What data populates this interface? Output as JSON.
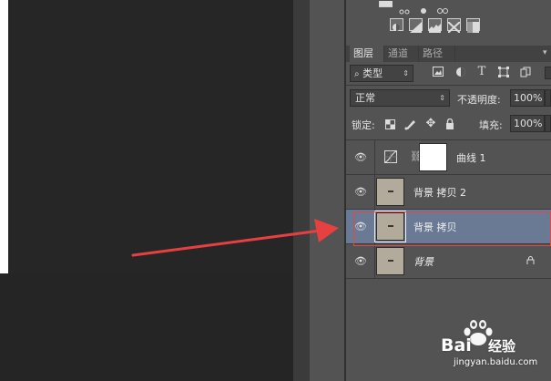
{
  "adjustments_panel": {
    "icons_row1": [
      "levels-icon",
      "curves-mini-icon",
      "exposure-icon",
      "vibrance-icon"
    ],
    "icons_row2": [
      "invert-icon",
      "posterize-icon",
      "threshold-icon",
      "selective-color-icon",
      "gradient-map-icon"
    ]
  },
  "layers_panel": {
    "tabs": [
      {
        "label": "图层",
        "active": true
      },
      {
        "label": "通道",
        "active": false
      },
      {
        "label": "路径",
        "active": false
      }
    ],
    "filter": {
      "icon": "search-icon",
      "value": "类型"
    },
    "filter_icons": [
      "image-filter-icon",
      "adjustment-filter-icon",
      "text-filter-icon",
      "shape-filter-icon",
      "smart-object-filter-icon"
    ],
    "blend_mode": "正常",
    "opacity_label": "不透明度:",
    "opacity_value": "100%",
    "lock_label": "锁定:",
    "fill_label": "填充:",
    "fill_value": "100%",
    "layers": [
      {
        "name": "曲线 1",
        "type": "adjustment",
        "visible": true,
        "selected": false
      },
      {
        "name": "背景 拷贝 2",
        "type": "image",
        "visible": true,
        "selected": false
      },
      {
        "name": "背景 拷贝",
        "type": "image",
        "visible": true,
        "selected": true
      },
      {
        "name": "背景",
        "type": "background",
        "visible": true,
        "selected": false,
        "locked": true
      }
    ]
  },
  "colors": {
    "accent_selection": "#6a7a95",
    "annotation_red": "#e04848",
    "panel_bg": "#535353"
  },
  "watermark": {
    "brand": "Bai",
    "cn": "经验",
    "url": "jingyan.baidu.com"
  }
}
